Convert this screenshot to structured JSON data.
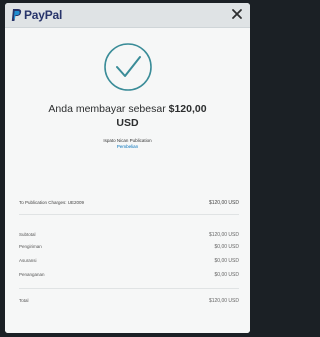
{
  "header": {
    "brand": "PayPal"
  },
  "confirmation": {
    "headline_prefix": "Anda membayar sebesar",
    "amount": "$120,00",
    "currency": "USD",
    "merchant_name": "Ispato Nican Publication",
    "merchant_link": "Pembelian"
  },
  "item": {
    "description": "To Publication Charges: UE2009",
    "amount": "$120,00 USD"
  },
  "summary": [
    {
      "label": "Subtotal",
      "value": "$120,00 USD"
    },
    {
      "label": "Pengiriman",
      "value": "$0,00 USD"
    },
    {
      "label": "Asuransi",
      "value": "$0,00 USD"
    },
    {
      "label": "Penanganan",
      "value": "$0,00 USD"
    }
  ],
  "total": {
    "label": "Total",
    "value": "$120,00 USD"
  },
  "colors": {
    "brand_navy": "#27346a",
    "brand_blue": "#0070ba",
    "check_teal": "#3a8c98"
  },
  "icons": [
    "paypal-logo-icon",
    "close-icon",
    "check-circle-icon"
  ]
}
